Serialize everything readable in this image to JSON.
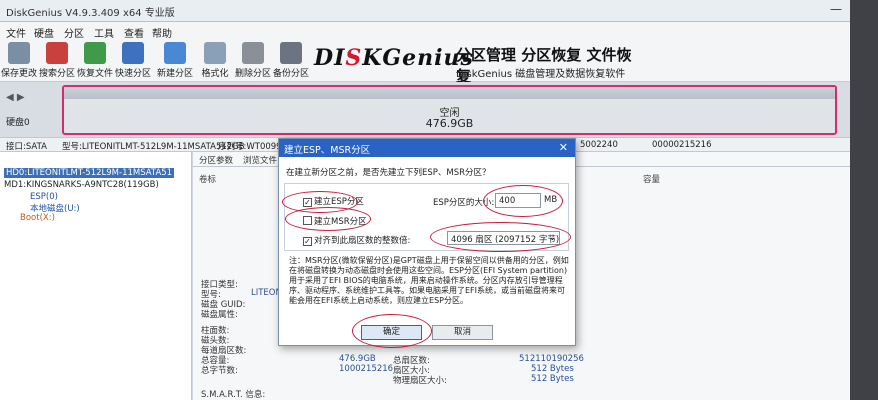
{
  "window": {
    "title": "DiskGenius V4.9.3.409 x64 专业版",
    "minimize": "—"
  },
  "menu": [
    "文件",
    "硬盘",
    "分区",
    "工具",
    "查看",
    "帮助"
  ],
  "toolbar": [
    {
      "label": "保存更改",
      "icon": "save-icon",
      "color": "#7c8ea3"
    },
    {
      "label": "搜索分区",
      "icon": "search-partition-icon",
      "color": "#c9413f"
    },
    {
      "label": "恢复文件",
      "icon": "recover-files-icon",
      "color": "#3f9a4a"
    },
    {
      "label": "快速分区",
      "icon": "quick-partition-icon",
      "color": "#3d72c0"
    },
    {
      "label": "新建分区",
      "icon": "new-partition-icon",
      "color": "#4a88d6"
    },
    {
      "label": "格式化",
      "icon": "format-icon",
      "color": "#8aa0b8"
    },
    {
      "label": "删除分区",
      "icon": "delete-partition-icon",
      "color": "#8a8f98"
    },
    {
      "label": "备份分区",
      "icon": "backup-partition-icon",
      "color": "#6b7480"
    }
  ],
  "brand": {
    "logo_left": "DI",
    "logo_mid": "S",
    "logo_right": "KGenius",
    "slogan": "分区管理 分区恢复 文件恢复",
    "tagline": "DiskGenius 磁盘管理及数据恢复软件"
  },
  "diskbar": {
    "nav": "◀ ▶",
    "disk_label": "硬盘0",
    "partition_name": "空闲",
    "partition_size": "476.9GB"
  },
  "infostrip": {
    "interface": "接口:SATA",
    "model": "型号:LITEONITLMT-512L9M-11MSATA512GB",
    "serial": "序列号:WT00994",
    "sectors": "5002240",
    "size_bytes": "00000215216"
  },
  "tree": [
    {
      "label": "HD0:LITEONITLMT-512L9M-11MSATA51",
      "style": "sel"
    },
    {
      "label": "MD1:KINGSNARKS-A9NTC28(119GB)",
      "style": ""
    },
    {
      "label": "ESP(0)",
      "style": "blue"
    },
    {
      "label": "本地磁盘(U:)",
      "style": "blue"
    },
    {
      "label": "Boot(X:)",
      "style": "orange"
    }
  ],
  "tabs": [
    "分区参数",
    "浏览文件"
  ],
  "columns": [
    "卷标",
    "容量"
  ],
  "properties": [
    {
      "label": "接口类型:",
      "value": ""
    },
    {
      "label": "型号:",
      "value": "LITEONIT"
    },
    {
      "label": "磁盘 GUID:",
      "value": ""
    },
    {
      "label": "磁盘属性:",
      "value": ""
    },
    {
      "label": "柱面数:",
      "value": ""
    },
    {
      "label": "磁头数:",
      "value": ""
    },
    {
      "label": "每道扇区数:",
      "value": ""
    },
    {
      "label": "总容量:",
      "value": "476.9GB"
    },
    {
      "label": "总字节数:",
      "value": "1000215216"
    }
  ],
  "properties_right": [
    {
      "label": "总扇区数:",
      "value": "512110190256"
    },
    {
      "label": "扇区大小:",
      "value": "512 Bytes"
    },
    {
      "label": "物理扇区大小:",
      "value": "512 Bytes"
    }
  ],
  "smart_label": "S.M.A.R.T. 信息:",
  "dialog": {
    "title": "建立ESP、MSR分区",
    "close": "✕",
    "question": "在建立新分区之前，是否先建立下列ESP、MSR分区？",
    "create_esp": {
      "label": "建立ESP分区",
      "checked": true
    },
    "create_msr": {
      "label": "建立MSR分区",
      "checked": false
    },
    "align": {
      "label": "对齐到此扇区数的整数倍:",
      "checked": true
    },
    "esp_size_label": "ESP分区的大小:",
    "esp_size_value": "400",
    "esp_size_unit": "MB",
    "align_value": "4096 扇区 (2097152 字节)",
    "note": "注：MSR分区(微软保留分区)是GPT磁盘上用于保留空间以供备用的分区，例如在将磁盘转换为动态磁盘时会使用这些空间。ESP分区(EFI System partition)用于采用了EFI BIOS的电脑系统，用来启动操作系统。分区内存放引导管理程序、驱动程序、系统维护工具等。如果电脑采用了EFI系统，或当前磁盘将来可能会用在EFI系统上启动系统，则应建立ESP分区。",
    "ok": "确定",
    "cancel": "取消"
  },
  "colors": {
    "accent": "#2a63c4",
    "partition_border": "#d22d6e",
    "ink": "#c81c3d"
  }
}
